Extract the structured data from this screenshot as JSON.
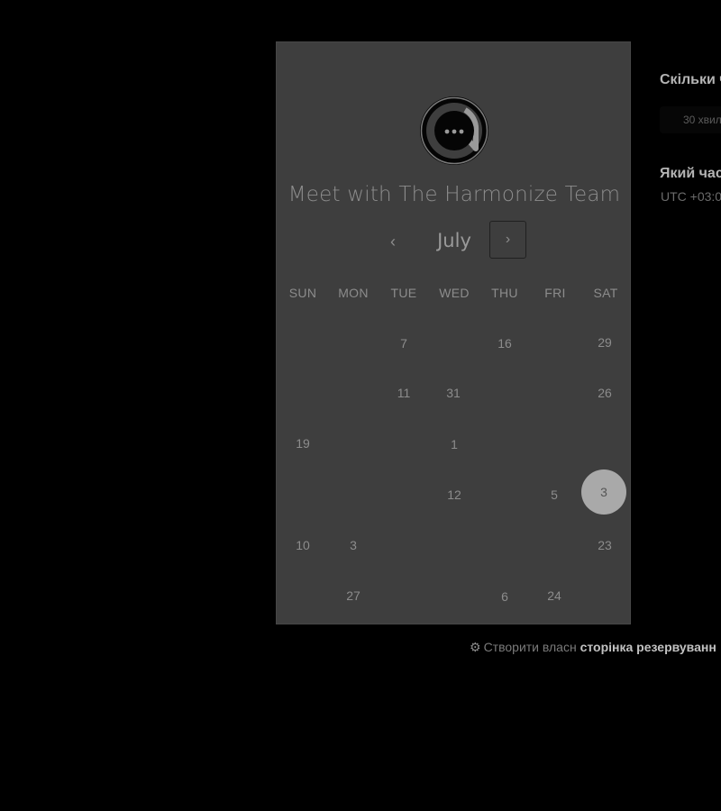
{
  "card": {
    "title": "Meet with The Harmonize Team",
    "month": "July",
    "prev_label": "‹",
    "next_label": "›",
    "logo_icon": "chat-bubble-icon"
  },
  "calendar": {
    "weekdays": [
      "SUN",
      "MON",
      "TUE",
      "WED",
      "THU",
      "FRI",
      "SAT"
    ],
    "rows": [
      [
        "",
        "",
        "7",
        "",
        "16",
        "",
        "29"
      ],
      [
        "",
        "",
        "11",
        "31",
        "",
        "",
        "26"
      ],
      [
        "19",
        "",
        "",
        "1",
        "",
        "",
        ""
      ],
      [
        "",
        "",
        "",
        "12",
        "",
        "5",
        "3"
      ],
      [
        "10",
        "3",
        "",
        "",
        "",
        "",
        "23"
      ],
      [
        "",
        "27",
        "",
        "",
        "6",
        "24",
        ""
      ]
    ],
    "selected": "3"
  },
  "footer": {
    "prefix": "Створити власн",
    "strong": "сторінка резервуванн"
  },
  "side": {
    "duration_heading": "Скільки ч",
    "duration_value": "30 хвил",
    "time_heading": "Який час",
    "timezone": "UTC +03:0"
  },
  "colors": {
    "background": "#000000",
    "card": "#3e3e3e",
    "selected_day": "#a9a9a9"
  }
}
